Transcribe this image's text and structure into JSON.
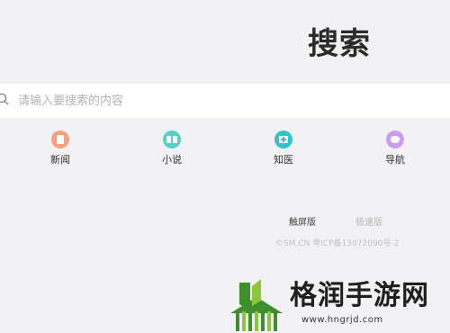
{
  "brand": {
    "logo_text": "搜索"
  },
  "search": {
    "placeholder": "请输入要搜索的内容",
    "value": ""
  },
  "nav": [
    {
      "label": "新闻",
      "icon": "news-icon",
      "color": "#f5a07f"
    },
    {
      "label": "小说",
      "icon": "novel-icon",
      "color": "#59d0c6"
    },
    {
      "label": "知医",
      "icon": "medical-icon",
      "color": "#34c3c8"
    },
    {
      "label": "导航",
      "icon": "navigation-icon",
      "color": "#cc9cee"
    }
  ],
  "footer": {
    "touch_version": "触屏版",
    "fast_version": "极速版",
    "copyright": "©SM.CN 粤ICP备13072090号-2"
  },
  "watermark": {
    "title": "格润手游网",
    "url": "www.hngrjd.com",
    "colors": {
      "green": "#3c8f2c",
      "light_green": "#8cc63f"
    }
  }
}
